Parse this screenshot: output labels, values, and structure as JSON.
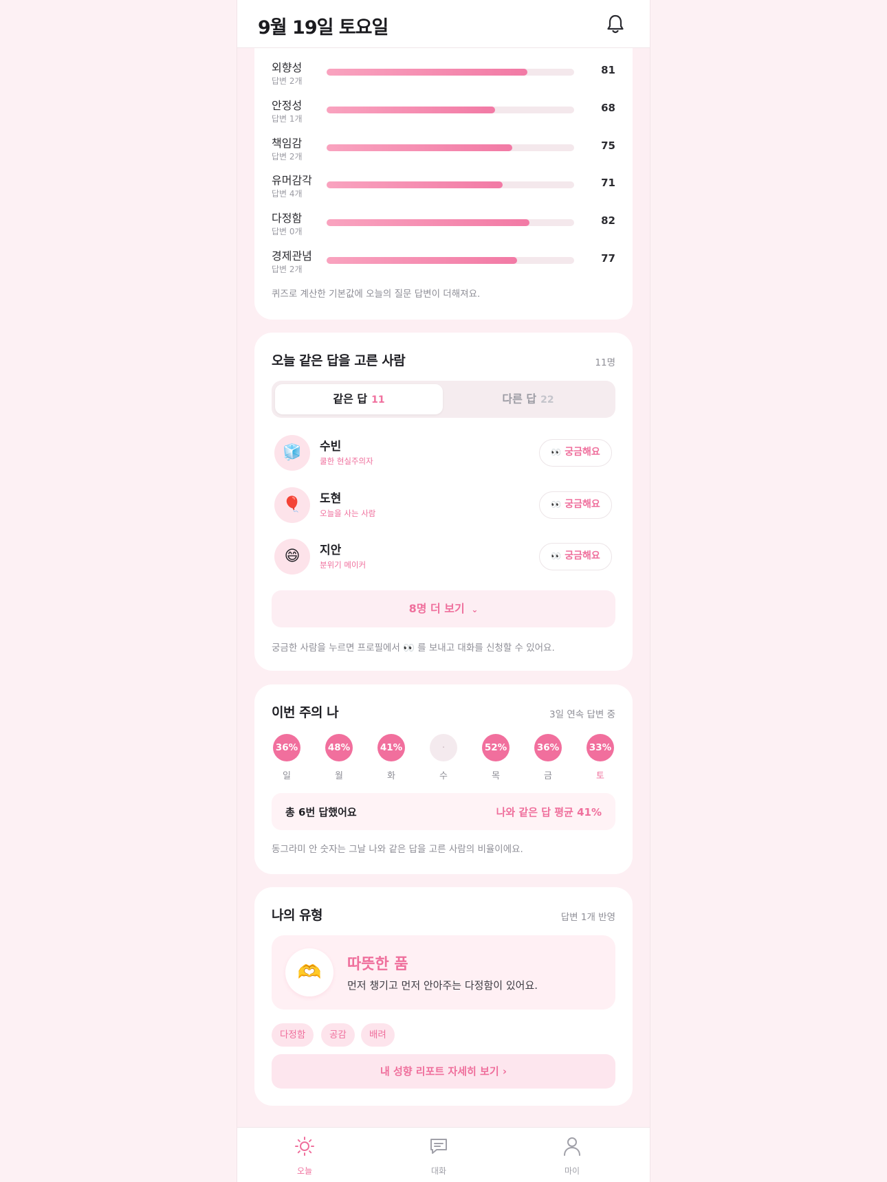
{
  "header": {
    "title": "9월 19일 토요일"
  },
  "traits": {
    "items": [
      {
        "name": "외향성",
        "sub": "답변 2개",
        "value": 81
      },
      {
        "name": "안정성",
        "sub": "답변 1개",
        "value": 68
      },
      {
        "name": "책임감",
        "sub": "답변 2개",
        "value": 75
      },
      {
        "name": "유머감각",
        "sub": "답변 4개",
        "value": 71
      },
      {
        "name": "다정함",
        "sub": "답변 0개",
        "value": 82
      },
      {
        "name": "경제관념",
        "sub": "답변 2개",
        "value": 77
      }
    ],
    "note": "퀴즈로 계산한 기본값에 오늘의 질문 답변이 더해져요."
  },
  "same_answer": {
    "title": "오늘 같은 답을 고른 사람",
    "count": "11명",
    "tab_same_label": "같은 답",
    "tab_same_count": "11",
    "tab_diff_label": "다른 답",
    "tab_diff_count": "22",
    "people": [
      {
        "name": "수빈",
        "tag": "쿨한 현실주의자",
        "emoji": "🧊",
        "button": "궁금해요"
      },
      {
        "name": "도현",
        "tag": "오늘을 사는 사람",
        "emoji": "🎈",
        "button": "궁금해요"
      },
      {
        "name": "지안",
        "tag": "분위기 메이커",
        "emoji": "😄",
        "button": "궁금해요"
      }
    ],
    "eyes": "👀",
    "more_label": "8명 더 보기",
    "note": "궁금한 사람을 누르면 프로필에서 👀 를 보내고 대화를 신청할 수 있어요."
  },
  "week": {
    "title": "이번 주의 나",
    "streak": "3일 연속 답변 중",
    "days": [
      {
        "label": "일",
        "value": "36%"
      },
      {
        "label": "월",
        "value": "48%"
      },
      {
        "label": "화",
        "value": "41%"
      },
      {
        "label": "수",
        "value": "·"
      },
      {
        "label": "목",
        "value": "52%"
      },
      {
        "label": "금",
        "value": "36%"
      },
      {
        "label": "토",
        "value": "33%"
      }
    ],
    "summary_left": "총 6번 답했어요",
    "summary_right": "나와 같은 답 평균 41%",
    "note": "동그라미 안 숫자는 그날 나와 같은 답을 고른 사람의 비율이에요."
  },
  "my_type": {
    "title": "나의 유형",
    "meta": "답변 1개 반영",
    "emoji": "🫶",
    "name": "따뜻한 품",
    "desc": "먼저 챙기고 먼저 안아주는 다정함이 있어요.",
    "chips": [
      "다정함",
      "공감",
      "배려"
    ],
    "report_label": "내 성향 리포트 자세히 보기 ›"
  },
  "nav": {
    "today": "오늘",
    "chat": "대화",
    "my": "마이"
  },
  "colors": {
    "accent": "#ef6f9c",
    "background": "#fdeff3"
  }
}
